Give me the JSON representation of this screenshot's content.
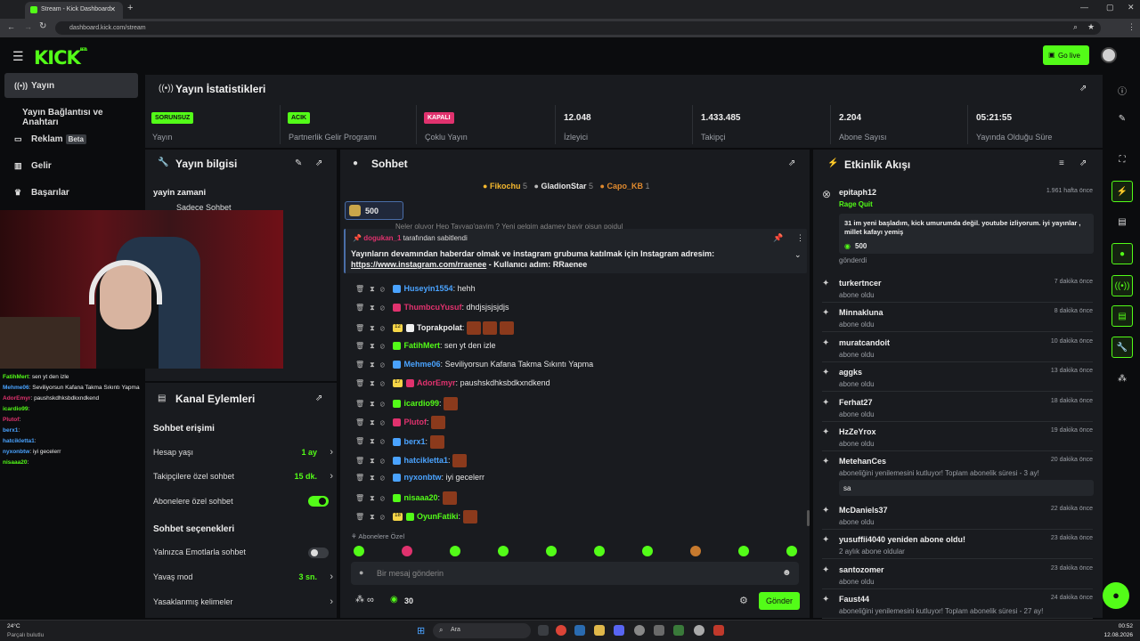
{
  "browser": {
    "tab_title": "Stream - Kick Dashboard",
    "url": "dashboard.kick.com/stream"
  },
  "header": {
    "logo": "KICK",
    "logo_sup": "BETA",
    "go_live": "Go live"
  },
  "nav": {
    "items": [
      {
        "label": "Yayın"
      },
      {
        "label": "Yayın Bağlantısı ve Anahtarı"
      },
      {
        "label": "Reklam",
        "badge": "Beta"
      },
      {
        "label": "Gelir"
      },
      {
        "label": "Başarılar"
      }
    ]
  },
  "stats": {
    "title": "Yayın İstatistikleri",
    "items": [
      {
        "badge": "SORUNSUZ",
        "label": "Yayın"
      },
      {
        "badge": "ACIK",
        "label": "Partnerlik Gelir Programı"
      },
      {
        "badge": "KAPALI",
        "label": "Çoklu Yayın"
      },
      {
        "value": "12.048",
        "label": "İzleyici"
      },
      {
        "value": "1.433.485",
        "label": "Takipçi"
      },
      {
        "value": "2.204",
        "label": "Abone Sayısı"
      },
      {
        "value": "05:21:55",
        "label": "Yayında Olduğu Süre"
      }
    ]
  },
  "info": {
    "title": "Yayın bilgisi",
    "stream_title": "yayin zamani",
    "category": "Sadece Sohbet"
  },
  "channel": {
    "title": "Kanal Eylemleri",
    "access_title": "Sohbet erişimi",
    "account_age_label": "Hesap yaşı",
    "account_age_value": "1 ay",
    "followers_label": "Takipçilere özel sohbet",
    "followers_value": "15 dk.",
    "subs_label": "Abonelere özel sohbet",
    "options_title": "Sohbet seçenekleri",
    "emote_label": "Yalnızca Emotlarla sohbet",
    "slow_label": "Yavaş mod",
    "slow_value": "3 sn.",
    "banned_label": "Yasaklanmış kelimeler"
  },
  "chat": {
    "title": "Sohbet",
    "top_gifters": [
      {
        "name": "Fikochu",
        "count": "5"
      },
      {
        "name": "GladionStar",
        "count": "5"
      },
      {
        "name": "Capo_KB",
        "count": "1"
      }
    ],
    "kicks": "500",
    "partial_text": "Neler oluyor Hep Tayyap'gayim ? Yeni gelgim adamey bayir oisun poidul",
    "pinned_by": "dogukan_1",
    "pinned_suffix": "tarafından sabitlendi",
    "pinned_text": "Yayınların devamından haberdar olmak ve instagram grubuma katılmak için Instagram adresim:",
    "pinned_link": "https://www.instagram.com/rraenee",
    "pinned_tail": " - Kullanıcı adım: RRaenee",
    "messages": [
      {
        "user": "Huseyin1554",
        "color": "#4aa3ff",
        "text": "hehh",
        "sub": ""
      },
      {
        "user": "ThumbcuYusuf",
        "color": "#e0326e",
        "text": "dhdjsjsjsjdjs",
        "sub": ""
      },
      {
        "user": "Toprakpolat",
        "color": "#f0f0f0",
        "text": "",
        "sub": "12"
      },
      {
        "user": "FatihMert",
        "color": "#53fc18",
        "text": "sen yt den izle",
        "sub": ""
      },
      {
        "user": "Mehme06",
        "color": "#4aa3ff",
        "text": "Seviliyorsun Kafana Takma Sıkıntı Yapma",
        "sub": ""
      },
      {
        "user": "AdorEmyr",
        "color": "#e0326e",
        "text": "paushskdhksbdkxndkend",
        "sub": "17"
      },
      {
        "user": "icardio99",
        "color": "#53fc18",
        "text": "",
        "sub": ""
      },
      {
        "user": "Plutof",
        "color": "#e0326e",
        "text": "",
        "sub": ""
      },
      {
        "user": "berx1",
        "color": "#4aa3ff",
        "text": "",
        "sub": ""
      },
      {
        "user": "hatcikletta1",
        "color": "#4aa3ff",
        "text": "",
        "sub": ""
      },
      {
        "user": "nyxonbtw",
        "color": "#4aa3ff",
        "text": "iyi gecelerr",
        "sub": ""
      },
      {
        "user": "nisaaa20",
        "color": "#53fc18",
        "text": "",
        "sub": ""
      },
      {
        "user": "OyunFatiki",
        "color": "#53fc18",
        "text": "",
        "sub": "18"
      }
    ],
    "subs_label": "Abonelere Özel",
    "input_placeholder": "Bir mesaj gönderin",
    "points": "30",
    "send": "Gönder"
  },
  "events": {
    "title": "Etkinlik Akışı",
    "items": [
      {
        "name": "epitaph12",
        "sub": "Rage Quit",
        "time": "1.961 hafta önce",
        "message": "31 im yeni başladım, kick umurumda değil. youtube izliyorum. iyi yayınlar , millet kafayı yemiş",
        "amount": "500",
        "footer": "gönderdi"
      },
      {
        "name": "turkertncer",
        "sub": "abone oldu",
        "time": "7 dakika önce"
      },
      {
        "name": "Minnakluna",
        "sub": "abone oldu",
        "time": "8 dakika önce"
      },
      {
        "name": "muratcandoit",
        "sub": "abone oldu",
        "time": "10 dakika önce"
      },
      {
        "name": "aggks",
        "sub": "abone oldu",
        "time": "13 dakika önce"
      },
      {
        "name": "Ferhat27",
        "sub": "abone oldu",
        "time": "18 dakika önce"
      },
      {
        "name": "HzZeYrox",
        "sub": "abone oldu",
        "time": "19 dakika önce"
      },
      {
        "name": "MetehanCes",
        "sub": "aboneliğini yenilemesini kutluyor! Toplam abonelik süresi - 3 ay!",
        "time": "20 dakika önce",
        "message": "sa"
      },
      {
        "name": "McDaniels37",
        "sub": "abone oldu",
        "time": "22 dakika önce"
      },
      {
        "name": "yusuffii4040 yeniden abone oldu!",
        "sub": "2 aylık abone oldular",
        "time": "23 dakika önce"
      },
      {
        "name": "santozomer",
        "sub": "abone oldu",
        "time": "23 dakika önce"
      },
      {
        "name": "Faust44",
        "sub": "aboneliğini yenilemesini kutluyor! Toplam abonelik süresi - 27 ay!",
        "time": "24 dakika önce"
      }
    ]
  },
  "overlay_chat": [
    {
      "user": "FatihMert",
      "text": "sen yt den izle",
      "color": "#53fc18"
    },
    {
      "user": "Mehme06",
      "text": "Seviliyorsun Kafana Takma Sıkıntı Yapma",
      "color": "#4aa3ff"
    },
    {
      "user": "AdorEmyr",
      "text": "paushskdhksbdkxndkend",
      "color": "#e0326e"
    },
    {
      "user": "icardio99",
      "text": "",
      "color": "#53fc18"
    },
    {
      "user": "Plutof",
      "text": "",
      "color": "#e0326e"
    },
    {
      "user": "berx1",
      "text": "",
      "color": "#4aa3ff"
    },
    {
      "user": "hatcikletta1",
      "text": "",
      "color": "#4aa3ff"
    },
    {
      "user": "nyxonbtw",
      "text": "iyi gecelerr",
      "color": "#4aa3ff"
    },
    {
      "user": "nisaaa20",
      "text": "",
      "color": "#53fc18"
    }
  ],
  "taskbar": {
    "temp": "24°C",
    "weather": "Parçalı bulutlu",
    "search": "Ara",
    "time": "00:52",
    "date": "12.08.2026"
  },
  "colors": {
    "accent": "#53fc18",
    "panel": "#191b1f",
    "bg": "#0b0c0e"
  }
}
